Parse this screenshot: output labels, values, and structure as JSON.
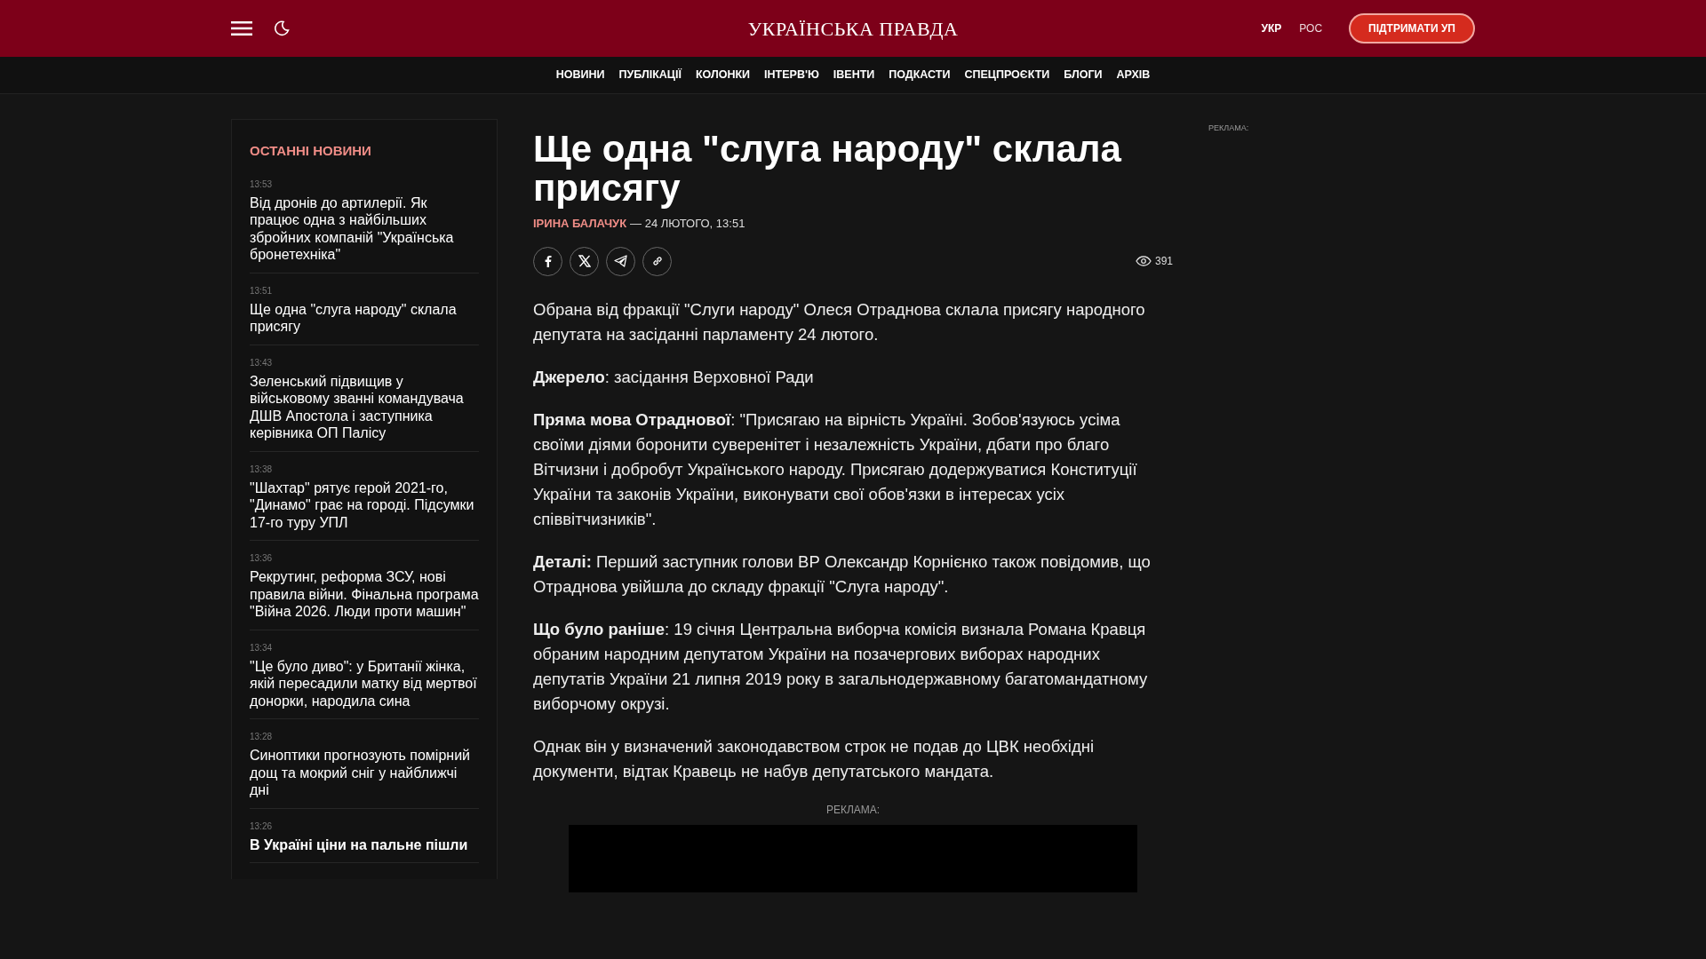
{
  "header": {
    "logo": "УКРАЇНСЬКА ПРАВДА",
    "languages": [
      {
        "label": "УКР",
        "selected": true
      },
      {
        "label": "РОС",
        "selected": false
      }
    ],
    "support_button": "ПІДТРИМАТИ УП"
  },
  "nav": [
    "НОВИНИ",
    "ПУБЛІКАЦІЇ",
    "КОЛОНКИ",
    "ІНТЕРВ'Ю",
    "ІВЕНТИ",
    "ПОДКАСТИ",
    "СПЕЦПРОЄКТИ",
    "БЛОГИ",
    "АРХІВ"
  ],
  "sidebar": {
    "title": "ОСТАННІ НОВИНИ",
    "items": [
      {
        "time": "13:53",
        "headline": "Від дронів до артилерії. Як працює одна з найбільших збройних компаній \"Українська бронетехніка\"",
        "bold": false
      },
      {
        "time": "13:51",
        "headline": "Ще одна \"слуга народу\" склала присягу",
        "bold": false
      },
      {
        "time": "13:43",
        "headline": "Зеленський підвищив у військовому званні командувача ДШВ Апостола і заступника керівника ОП Палісу",
        "bold": false
      },
      {
        "time": "13:38",
        "headline": "\"Шахтар\" рятує герой 2021-го, \"Динамо\" грає на городі. Підсумки 17-го туру УПЛ",
        "bold": false
      },
      {
        "time": "13:36",
        "headline": "Рекрутинг, реформа ЗСУ, нові правила війни. Фінальна програма \"Війна 2026. Люди проти машин\"",
        "bold": false
      },
      {
        "time": "13:34",
        "headline": "\"Це було диво\": у Британії жінка, якій пересадили матку від мертвої донорки, народила сина",
        "bold": false
      },
      {
        "time": "13:28",
        "headline": "Синоптики прогнозують помірний дощ та мокрий сніг у найближчі дні",
        "bold": false
      },
      {
        "time": "13:26",
        "headline": "В Україні ціни на пальне пішли",
        "bold": true
      }
    ]
  },
  "article": {
    "title": "Ще одна \"слуга народу\" склала присягу",
    "author": "ІРИНА БАЛАЧУК",
    "date": "— 24 ЛЮТОГО, 13:51",
    "views": "391",
    "share": [
      {
        "kind": "facebook"
      },
      {
        "kind": "x"
      },
      {
        "kind": "telegram"
      },
      {
        "kind": "link"
      }
    ],
    "paragraphs": [
      "Обрана від фракції \"Слуги народу\" Олеся Отраднова склала присягу народного депутата на засіданні парламенту 24 лютого.",
      "**Джерело**: засідання Верховної Ради",
      "**Пряма мова Отраднової**: \"Присягаю на вірність Україні. Зобов'язуюсь усіма своїми діями боронити суверенітет і незалежність України, дбати про благо Вітчизни і добробут Українського народу. Присягаю додержуватися Конституції України та законів України, виконувати свої обов'язки в інтересах усіх співвітчизників\".",
      "**Деталі:** Перший заступник голови ВР Олександр Корнієнко також повідомив, що Отраднова увійшла до складу фракції \"Слуга народу\".",
      "**Що було раніше**: 19 січня Центральна виборча комісія визнала Романа Кравця обраним народним депутатом України на позачергових виборах народних депутатів України 21 липня 2019 року в загальнодержавному багатомандатному виборчому окрузі.",
      "Однак він у визначений законодавством строк не подав до ЦВК необхідні документи, відтак Кравець не набув депутатського мандата."
    ],
    "ad_label": "РЕКЛАМА:"
  },
  "aside": {
    "ad_label": "РЕКЛАМА:"
  }
}
